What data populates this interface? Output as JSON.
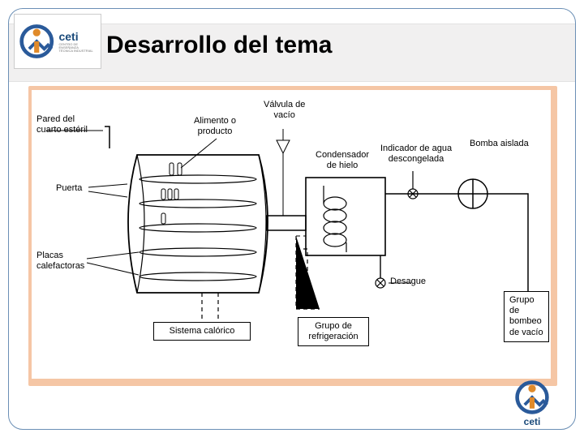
{
  "slide": {
    "title": "Desarrollo del tema"
  },
  "logo": {
    "name": "ceti",
    "subtitle1": "CENTRO DE ENSEÑANZA",
    "subtitle2": "TÉCNICA INDUSTRIAL"
  },
  "diagram": {
    "labels": {
      "wall": "Pared del\ncuarto estéril",
      "door": "Puerta",
      "plates": "Placas\ncalefactoras",
      "product": "Alimento o\nproducto",
      "vacuum_valve": "Válvula de\nvacío",
      "condenser": "Condensador\nde hielo",
      "water_indicator": "Indicador de agua\ndescongelada",
      "pump": "Bomba aislada",
      "drain": "Desague"
    },
    "boxes": {
      "caloric": "Sistema calórico",
      "refrig": "Grupo de\nrefrigeración",
      "vacuum_group": "Grupo\nde\nbombeo\nde vacío"
    }
  }
}
